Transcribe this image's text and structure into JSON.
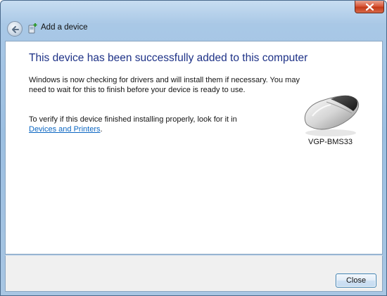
{
  "window": {
    "title": "Add a device"
  },
  "titlebar": {
    "close_icon": "close-icon",
    "back_icon": "back-arrow-icon"
  },
  "main": {
    "heading": "This device has been successfully added to this computer",
    "para1": "Windows is now checking for drivers and will install them if necessary. You may need to wait for this to finish before your device is ready to use.",
    "para2_text": "To verify if this device finished installing properly, look for it in",
    "para2_link": "Devices and Printers",
    "para2_end": "."
  },
  "device": {
    "name": "VGP-BMS33",
    "icon": "mouse-icon"
  },
  "footer": {
    "close_label": "Close"
  },
  "colors": {
    "heading": "#1e3287",
    "link": "#0b66c2",
    "titlebar": "#a9c8e6",
    "close": "#c33a18"
  }
}
